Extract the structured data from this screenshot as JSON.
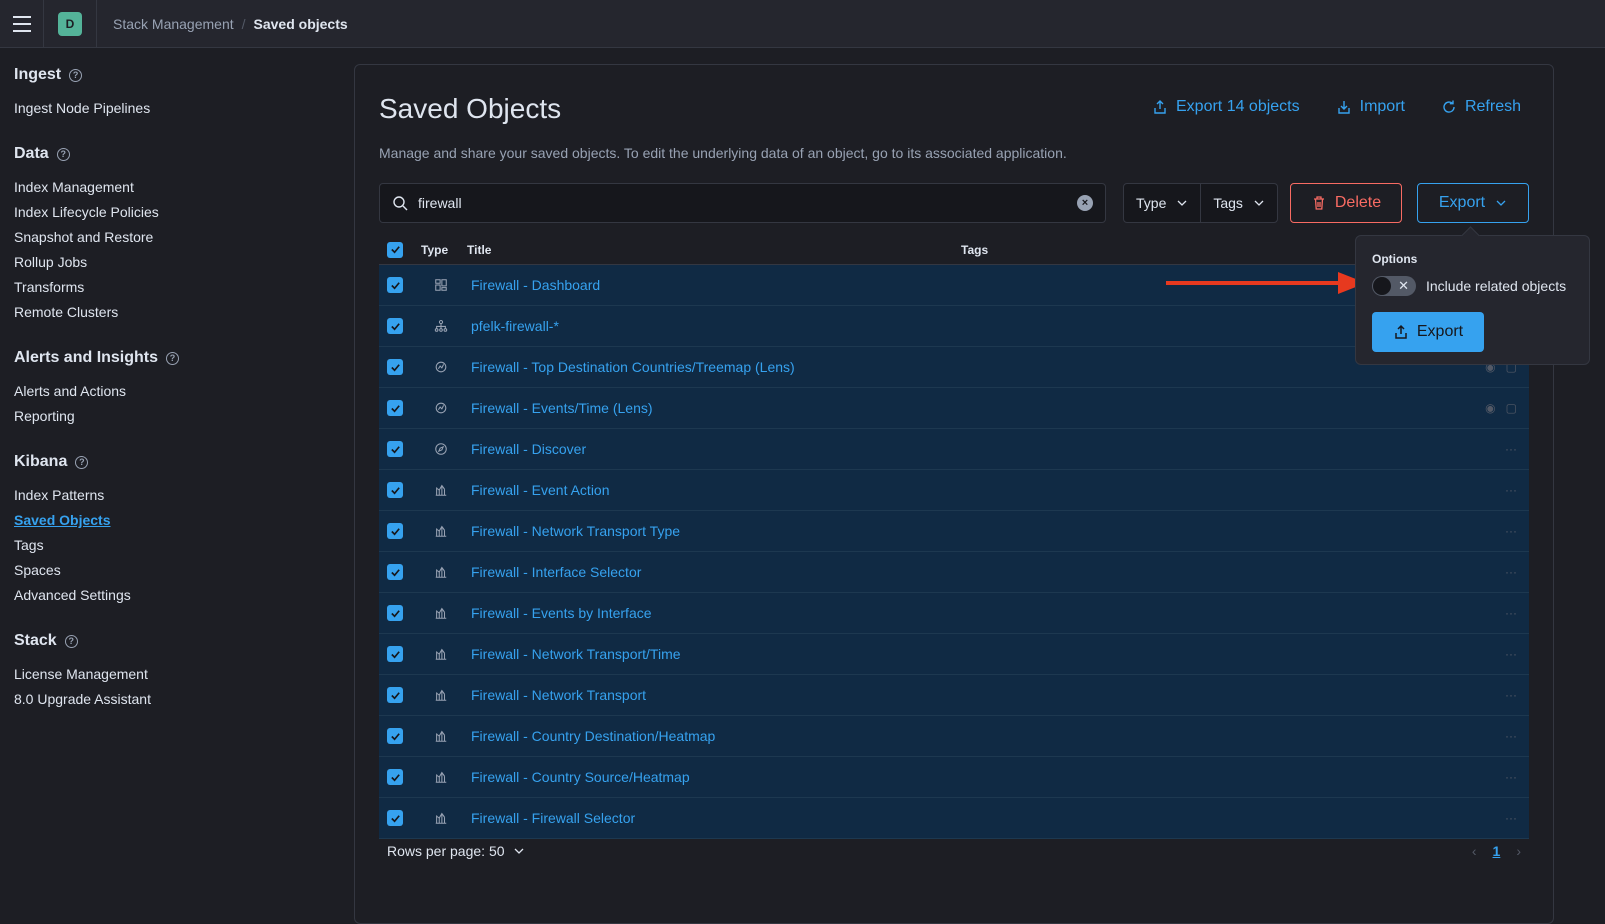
{
  "header": {
    "space_initial": "D",
    "breadcrumb_parent": "Stack Management",
    "breadcrumb_current": "Saved objects"
  },
  "sidebar": {
    "groups": [
      {
        "title": "Ingest",
        "items": [
          "Ingest Node Pipelines"
        ]
      },
      {
        "title": "Data",
        "items": [
          "Index Management",
          "Index Lifecycle Policies",
          "Snapshot and Restore",
          "Rollup Jobs",
          "Transforms",
          "Remote Clusters"
        ]
      },
      {
        "title": "Alerts and Insights",
        "items": [
          "Alerts and Actions",
          "Reporting"
        ]
      },
      {
        "title": "Kibana",
        "items": [
          "Index Patterns",
          "Saved Objects",
          "Tags",
          "Spaces",
          "Advanced Settings"
        ]
      },
      {
        "title": "Stack",
        "items": [
          "License Management",
          "8.0 Upgrade Assistant"
        ]
      }
    ],
    "active_item": "Saved Objects"
  },
  "page": {
    "title": "Saved Objects",
    "description": "Manage and share your saved objects. To edit the underlying data of an object, go to its associated application.",
    "export_all_label": "Export 14 objects",
    "import_label": "Import",
    "refresh_label": "Refresh"
  },
  "toolbar": {
    "search_value": "firewall",
    "type_filter": "Type",
    "tags_filter": "Tags",
    "delete_label": "Delete",
    "export_label": "Export"
  },
  "table": {
    "headers": {
      "type": "Type",
      "title": "Title",
      "tags": "Tags"
    },
    "rows": [
      {
        "icon": "dashboard-icon",
        "title": "Firewall - Dashboard"
      },
      {
        "icon": "index-pattern-icon",
        "title": "pfelk-firewall-*"
      },
      {
        "icon": "lens-icon",
        "title": "Firewall - Top Destination Countries/Treemap (Lens)"
      },
      {
        "icon": "lens-icon",
        "title": "Firewall - Events/Time (Lens)"
      },
      {
        "icon": "discover-icon",
        "title": "Firewall - Discover"
      },
      {
        "icon": "visualization-icon",
        "title": "Firewall - Event Action"
      },
      {
        "icon": "visualization-icon",
        "title": "Firewall - Network Transport Type"
      },
      {
        "icon": "visualization-icon",
        "title": "Firewall - Interface Selector"
      },
      {
        "icon": "visualization-icon",
        "title": "Firewall - Events by Interface"
      },
      {
        "icon": "visualization-icon",
        "title": "Firewall - Network Transport/Time"
      },
      {
        "icon": "visualization-icon",
        "title": "Firewall - Network Transport"
      },
      {
        "icon": "visualization-icon",
        "title": "Firewall - Country Destination/Heatmap"
      },
      {
        "icon": "visualization-icon",
        "title": "Firewall - Country Source/Heatmap"
      },
      {
        "icon": "visualization-icon",
        "title": "Firewall - Firewall Selector"
      }
    ]
  },
  "pagination": {
    "rows_per_page_label": "Rows per page: 50",
    "current_page": "1"
  },
  "export_popover": {
    "title": "Options",
    "toggle_label": "Include related objects",
    "toggle_on": false,
    "export_label": "Export"
  },
  "colors": {
    "accent": "#36a2ef",
    "danger": "#f86b63",
    "annotation_arrow": "#e7391f",
    "selected_row": "#102a44"
  }
}
